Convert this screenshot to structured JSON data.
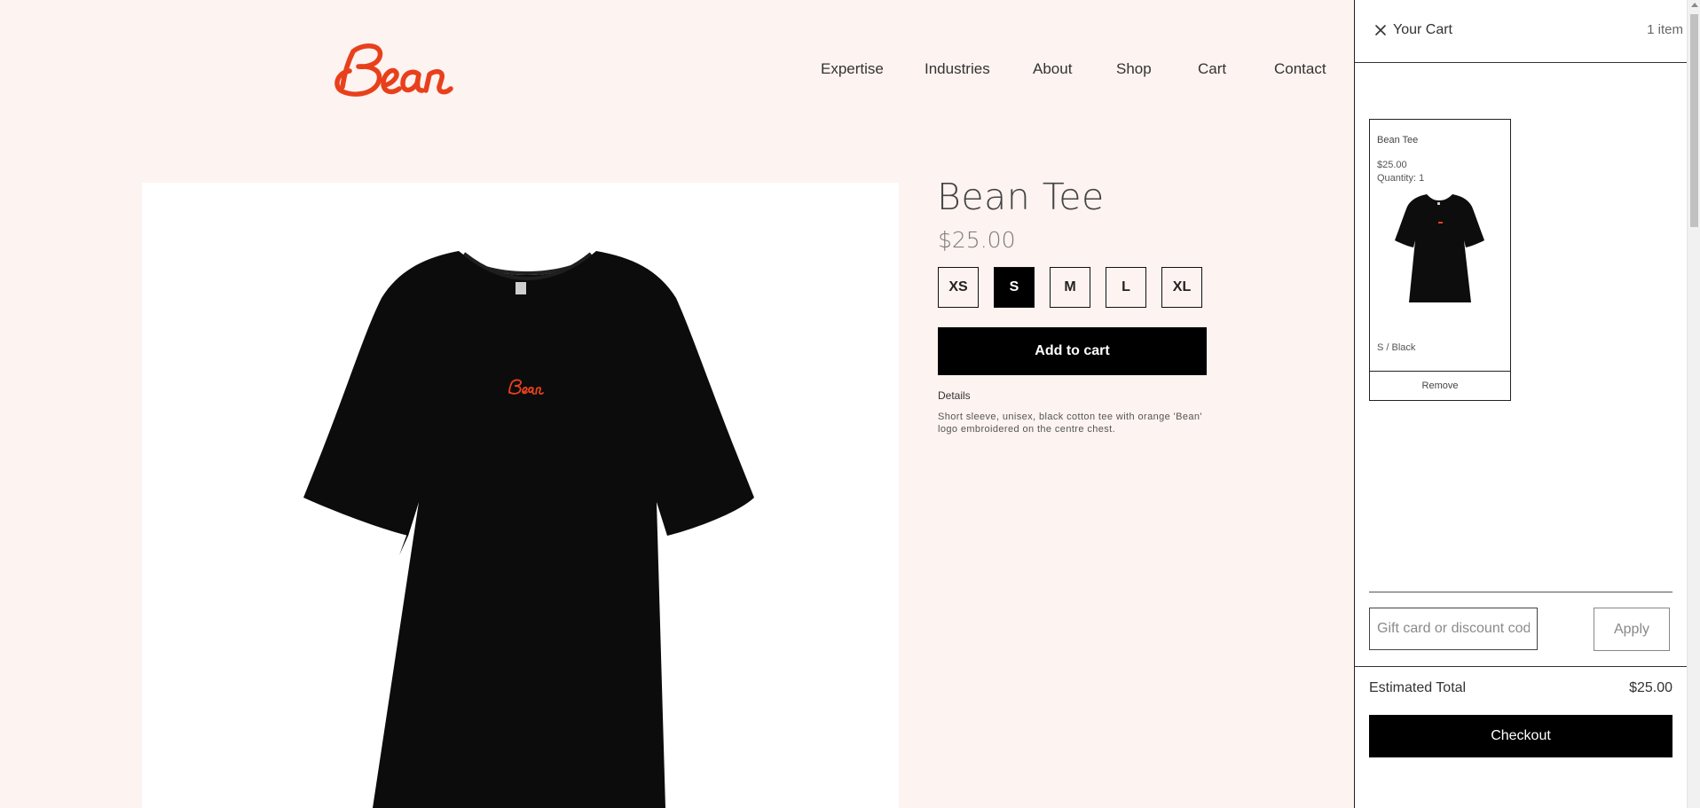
{
  "brand": {
    "logo_text": "Bean",
    "accent_color": "#e8401c"
  },
  "nav": {
    "items": [
      {
        "label": "Expertise"
      },
      {
        "label": "Industries"
      },
      {
        "label": "About"
      },
      {
        "label": "Shop"
      },
      {
        "label": "Cart"
      },
      {
        "label": "Contact"
      }
    ]
  },
  "product": {
    "title": "Bean Tee",
    "price": "$25.00",
    "sizes": [
      "XS",
      "S",
      "M",
      "L",
      "XL"
    ],
    "selected_size": "S",
    "add_to_cart_label": "Add to cart",
    "details_heading": "Details",
    "details_text": "Short sleeve, unisex, black cotton tee with orange 'Bean' logo embroidered on the centre chest.",
    "image_icon": "black-tshirt-with-orange-bean-logo"
  },
  "cart": {
    "title": "Your Cart",
    "count": "1 item",
    "close_icon": "close-icon",
    "items": [
      {
        "name": "Bean Tee",
        "price": "$25.00",
        "quantity": "Quantity: 1",
        "variant": "S / Black",
        "remove_label": "Remove"
      }
    ],
    "discount_placeholder": "Gift card or discount code",
    "apply_label": "Apply",
    "total_label": "Estimated Total",
    "total_value": "$25.00",
    "checkout_label": "Checkout"
  },
  "colors": {
    "page_background": "#fdf3f0",
    "primary_button": "#000000"
  }
}
